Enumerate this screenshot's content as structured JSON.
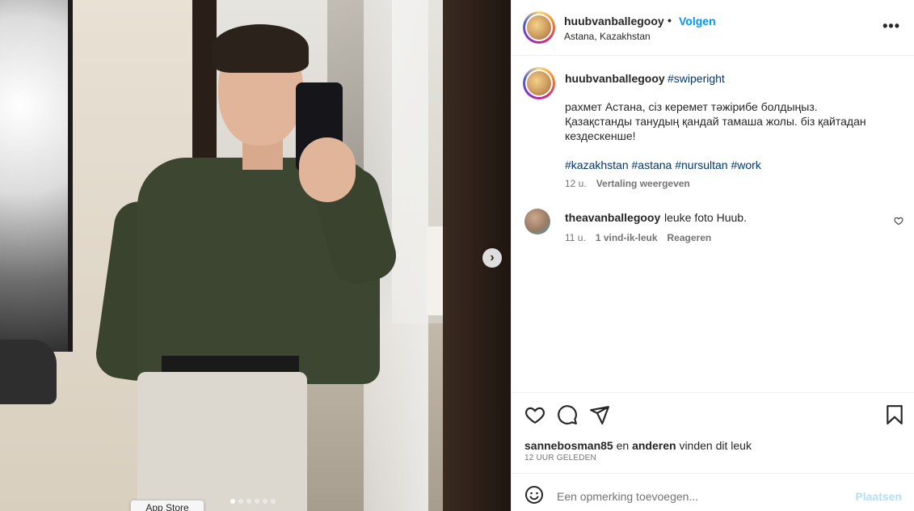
{
  "post": {
    "username": "huubvanballegooy",
    "separator": "•",
    "follow_label": "Volgen",
    "location": "Astana, Kazakhstan",
    "more_label": "•••"
  },
  "caption": {
    "username": "huubvanballegooy",
    "first_tag": "#swiperight",
    "text": "рахмет Астана, сіз керемет тәжірибе болдыңыз.\nҚазақстанды танудың қандай тамаша жолы. біз қайтадан\nкездескенше!",
    "hashtags": "#kazakhstan #astana #nursultan #work",
    "age": "12 u.",
    "translation_label": "Vertaling weergeven"
  },
  "comment": {
    "username": "theavanballegooy",
    "text": "leuke foto Huub.",
    "age": "11 u.",
    "likes": "1 vind-ik-leuk",
    "reply_label": "Reageren"
  },
  "likes": {
    "user": "sannebosman85",
    "connector": "en",
    "others": "anderen",
    "suffix": "vinden dit leuk"
  },
  "timestamp": "12 UUR GELEDEN",
  "comment_bar": {
    "placeholder": "Een opmerking toevoegen...",
    "post_label": "Plaatsen"
  },
  "carousel": {
    "slide_count": 6,
    "active_index": 0,
    "next_icon": "chevron-right-icon"
  },
  "tooltip": "App Store",
  "icons": [
    "heart-icon",
    "comment-icon",
    "share-icon",
    "bookmark-icon",
    "emoji-icon",
    "more-icon"
  ],
  "colors": {
    "link_blue": "#0095f6",
    "hashtag_blue": "#00376b",
    "muted": "#737373",
    "post_disabled": "#b2dffc"
  }
}
